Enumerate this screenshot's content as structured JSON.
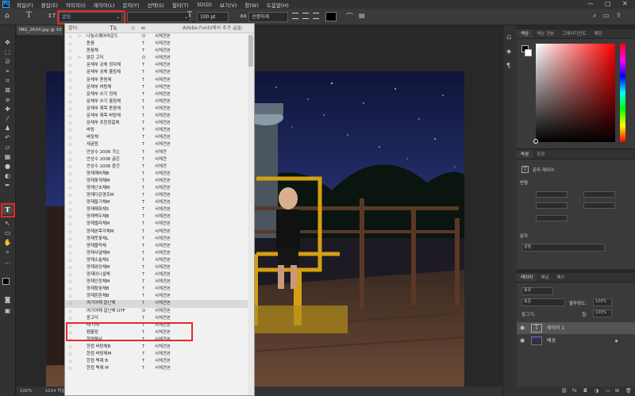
{
  "menubar": {
    "items": [
      "파일(F)",
      "편집(E)",
      "이미지(I)",
      "레이어(L)",
      "문자(Y)",
      "선택(S)",
      "필터(T)",
      "3D(D)",
      "보기(V)",
      "창(W)",
      "도움말(H)"
    ],
    "min": "—",
    "max": "□",
    "close": "✕",
    "logo": "Ps"
  },
  "options": {
    "font_family": "굴림",
    "font_style": "",
    "font_size": "100 pt",
    "antialias": "선명하게",
    "color": "#000000"
  },
  "doc_tab": {
    "label": "IMG_2634.jpg @ 10"
  },
  "status": {
    "zoom": "100%",
    "info": "1024 픽셀"
  },
  "font_dropdown": {
    "header_text": "Adobe Fonts에서 추가 글꼴:",
    "filter_label": "필터:",
    "rows": [
      {
        "name": "나눔스퀘어라운드",
        "type": "O",
        "sample": "서체견본",
        "expand": ">"
      },
      {
        "name": "돋움",
        "type": "T",
        "sample": "서체견본"
      },
      {
        "name": "돋움체",
        "type": "T",
        "sample": "서체견본"
      },
      {
        "name": "맑은 고딕",
        "type": "O",
        "sample": "서체견본",
        "expand": ">"
      },
      {
        "name": "문체부 궁체 정자체",
        "type": "T",
        "sample": "서체견본"
      },
      {
        "name": "문체부 궁체 흘림체",
        "type": "T",
        "sample": "서체견본"
      },
      {
        "name": "문체부 돋음체",
        "type": "T",
        "sample": "서체견본"
      },
      {
        "name": "문체부 바탕체",
        "type": "T",
        "sample": "서체견본"
      },
      {
        "name": "문체부 쓰기 정체",
        "type": "T",
        "sample": "서체견본"
      },
      {
        "name": "문체부 쓰기 흘림체",
        "type": "T",
        "sample": "서체견본"
      },
      {
        "name": "문체부 제목 돋음체",
        "type": "T",
        "sample": "서체견본"
      },
      {
        "name": "문체부 제목 바탕체",
        "type": "T",
        "sample": "서체견본"
      },
      {
        "name": "문체부 포런정흠체",
        "type": "T",
        "sample": "서체견본"
      },
      {
        "name": "바탕",
        "type": "T",
        "sample": "서체견본"
      },
      {
        "name": "바탕체",
        "type": "T",
        "sample": "서체견본"
      },
      {
        "name": "새굴림",
        "type": "T",
        "sample": "서체견본"
      },
      {
        "name": "안상수 2006 가는",
        "type": "T",
        "sample": "서체견"
      },
      {
        "name": "안상수 2006 굵은",
        "type": "T",
        "sample": "서체견"
      },
      {
        "name": "안상수 2006 중간",
        "type": "T",
        "sample": "서체견"
      },
      {
        "name": "양재깨비체B",
        "type": "T",
        "sample": "서체견본"
      },
      {
        "name": "양재꽃게체M",
        "type": "T",
        "sample": "서체견본"
      },
      {
        "name": "양재난초체M",
        "type": "T",
        "sample": "서체견본"
      },
      {
        "name": "양재다운명조M",
        "type": "T",
        "sample": "서체견본"
      },
      {
        "name": "양재둘기체M",
        "type": "T",
        "sample": "서체견본"
      },
      {
        "name": "양재매화체S",
        "type": "T",
        "sample": "서체견본"
      },
      {
        "name": "양재백두체B",
        "type": "T",
        "sample": "서체견본"
      },
      {
        "name": "양재벨라체M",
        "type": "T",
        "sample": "서체견본"
      },
      {
        "name": "양재본목각체M",
        "type": "T",
        "sample": "서체견본"
      },
      {
        "name": "양재붓꽃체L",
        "type": "T",
        "sample": "서체견본"
      },
      {
        "name": "양재블럭체",
        "type": "T",
        "sample": "서체견본"
      },
      {
        "name": "양재샤넬체M",
        "type": "T",
        "sample": "서체견본"
      },
      {
        "name": "양재소슬체S",
        "type": "T",
        "sample": "서체견본"
      },
      {
        "name": "양재와당체M",
        "type": "T",
        "sample": "서체견본"
      },
      {
        "name": "양재이니셜체",
        "type": "T",
        "sample": "서체견본"
      },
      {
        "name": "양재인장체M",
        "type": "T",
        "sample": "서체견본"
      },
      {
        "name": "양재참숯체B",
        "type": "T",
        "sample": "서체견본"
      },
      {
        "name": "양재튼튼체B",
        "type": "T",
        "sample": "서체견본"
      },
      {
        "name": "여기어때 잘난체",
        "type": "T",
        "sample": "서체견본",
        "highlight": true
      },
      {
        "name": "여기어때 잘난체 OTF",
        "type": "O",
        "sample": "서체견본"
      },
      {
        "name": "윤고딕",
        "type": "T",
        "sample": "서체견본"
      },
      {
        "name": "태 나무",
        "type": "T",
        "sample": "서체견본"
      },
      {
        "name": "펜흘림",
        "type": "T",
        "sample": "서체견본"
      },
      {
        "name": "한양해서",
        "type": "T",
        "sample": "서체견본"
      },
      {
        "name": "한컴 바탕체B",
        "type": "T",
        "sample": "서체견본"
      },
      {
        "name": "한컴 바탕체M",
        "type": "T",
        "sample": "서체견본"
      },
      {
        "name": "한컴 백제 B",
        "type": "T",
        "sample": "서체견본"
      },
      {
        "name": "한컴 백제 M",
        "type": "T",
        "sample": "서체견본"
      }
    ]
  },
  "color_panel": {
    "tabs": [
      "색상",
      "색상 견본",
      "그레이디언트",
      "패턴"
    ]
  },
  "properties_panel": {
    "tabs": [
      "속성",
      "조정"
    ],
    "layer_type": "문자 레이어",
    "transform": "변형",
    "char_section": "문자",
    "font": "굴림"
  },
  "layers_panel": {
    "tabs": [
      "레이어",
      "채널",
      "패스"
    ],
    "kind": "종류",
    "mode": "표준",
    "opacity_label": "불투명도:",
    "opacity": "100%",
    "lock_label": "잠그기:",
    "fill_label": "칠:",
    "fill": "100%",
    "layers": [
      {
        "name": "레이어 1",
        "type": "text",
        "selected": true
      },
      {
        "name": "배경",
        "type": "image",
        "selected": false
      }
    ]
  }
}
